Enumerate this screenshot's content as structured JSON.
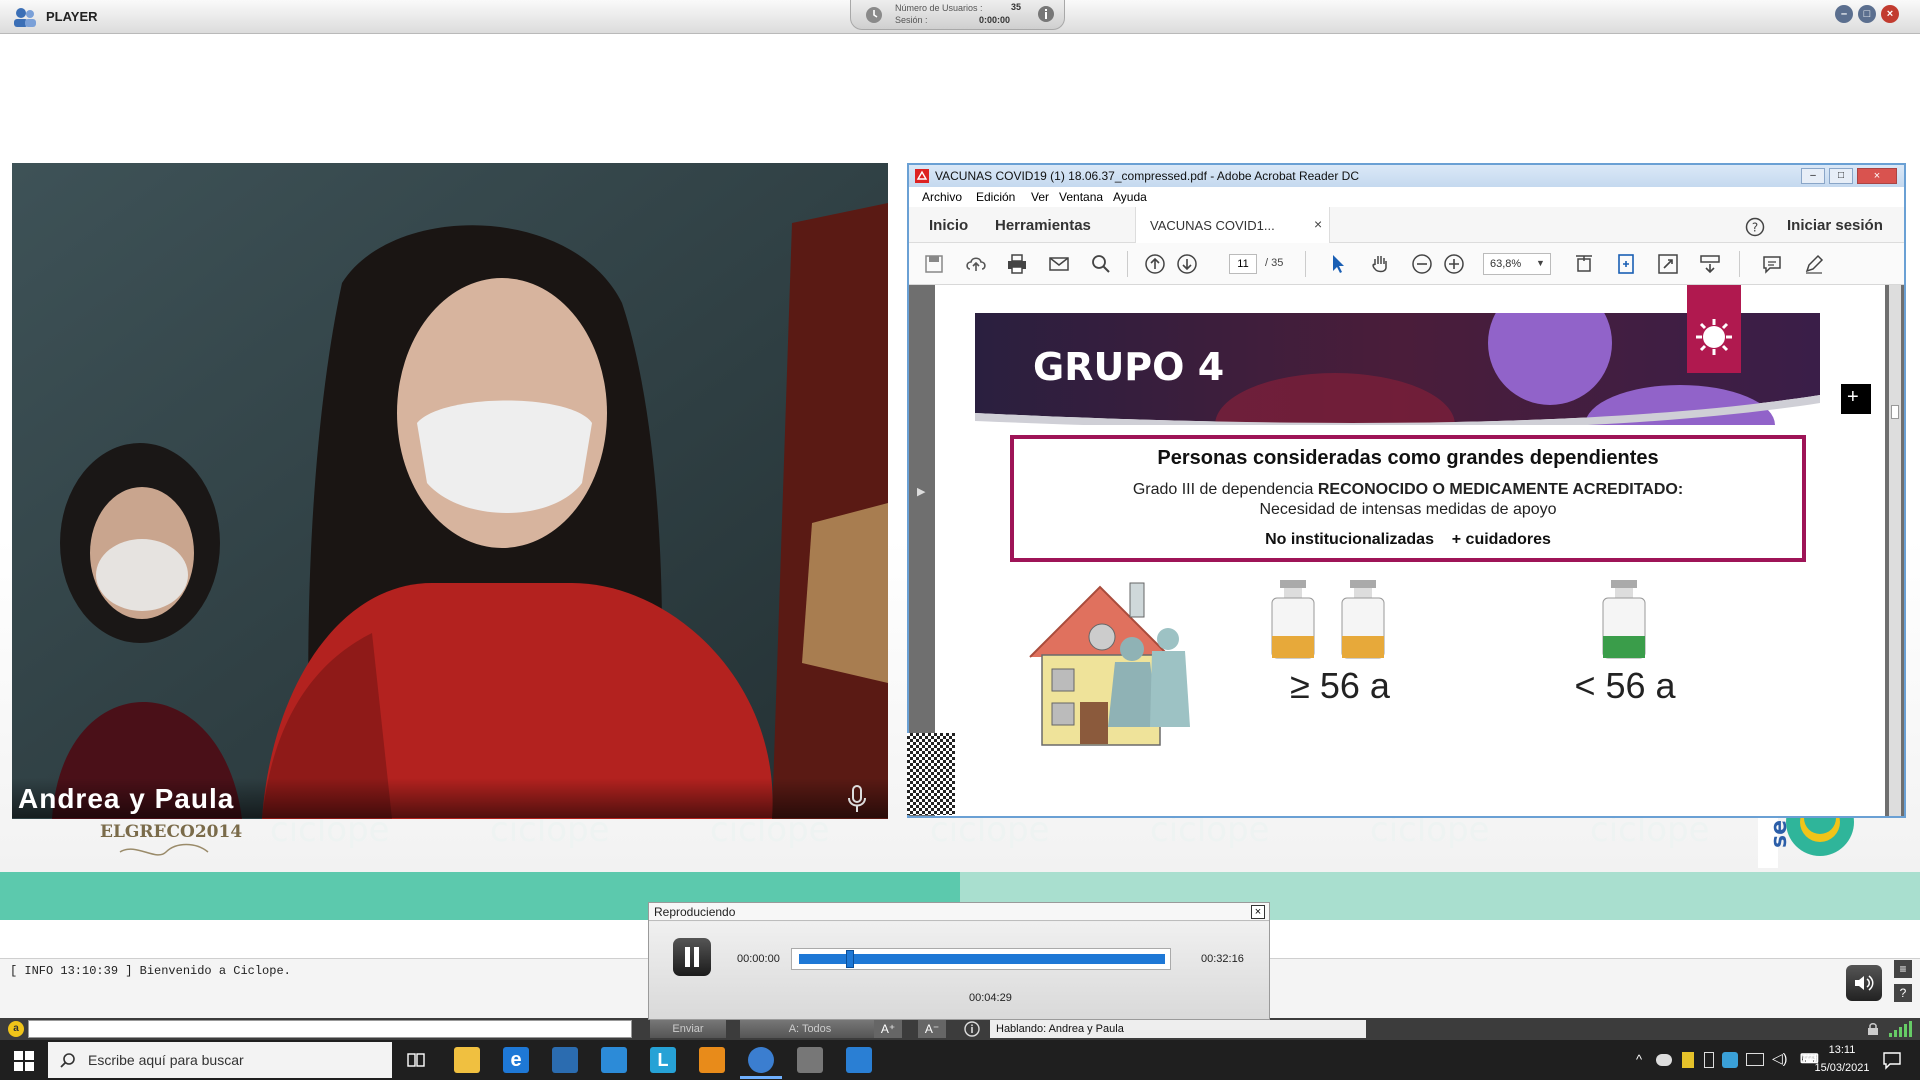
{
  "window": {
    "title": "PLAYER",
    "session": {
      "users_label": "Número de Usuarios :",
      "users_value": "35",
      "session_label": "Sesión :",
      "session_value": "0:00:00"
    }
  },
  "video": {
    "speaker_name": "Andrea y Paula"
  },
  "acrobat": {
    "title": "VACUNAS COVID19 (1) 18.06.37_compressed.pdf - Adobe Acrobat Reader DC",
    "menu": [
      "Archivo",
      "Edición",
      "Ver",
      "Ventana",
      "Ayuda"
    ],
    "tabs": {
      "home": "Inicio",
      "tools": "Herramientas",
      "document": "VACUNAS COVID1...",
      "signin": "Iniciar sesión"
    },
    "toolbar": {
      "page_current": "11",
      "page_total": "/ 35",
      "zoom": "63,8%"
    },
    "slide": {
      "heading": "GRUPO 4",
      "box_title": "Personas consideradas como grandes dependientes",
      "box_line1_a": "Grado III de dependencia ",
      "box_line1_b": "RECONOCIDO O MEDICAMENTE ACREDITADO:",
      "box_line2": "Necesidad de intensas medidas de apoyo",
      "box_line3_a": "No institucionalizadas",
      "box_line3_b": "+ cuidadores",
      "age_left": "≥ 56 a",
      "age_right": "< 56 a"
    }
  },
  "branding": {
    "logo_text": "ELGRECO2014"
  },
  "info": {
    "message": "[ INFO 13:10:39 ] Bienvenido a Ciclope."
  },
  "playback": {
    "title": "Reproduciendo",
    "time_start": "00:00:00",
    "time_end": "00:32:16",
    "time_current": "00:04:29",
    "progress_fraction": 0.14
  },
  "chat": {
    "send_label": "Enviar",
    "to_label": "A: Todos",
    "speaking": "Hablando: Andrea y Paula"
  },
  "taskbar": {
    "search_placeholder": "Escribe aquí para buscar",
    "time": "13:11",
    "date": "15/03/2021"
  }
}
